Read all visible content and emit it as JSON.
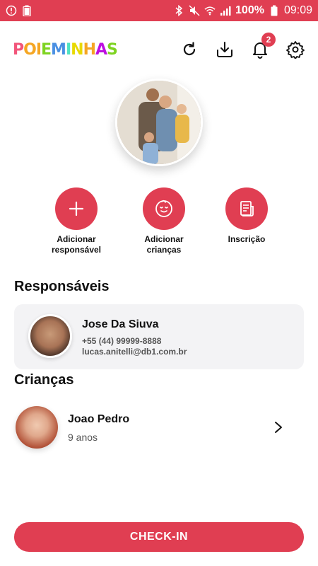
{
  "status_bar": {
    "battery_percent": "100%",
    "time": "09:09",
    "background": "#e03e52"
  },
  "header": {
    "logo_letters": [
      "P",
      "O",
      "I",
      "E",
      "M",
      "I",
      "N",
      "H",
      "A",
      "S"
    ],
    "logo_colors": [
      "#f2557a",
      "#f5a623",
      "#f5a623",
      "#7ed321",
      "#4a90e2",
      "#50e3c2",
      "#e8d900",
      "#f5a623",
      "#bd10e0",
      "#7ed321"
    ],
    "notification_count": "2",
    "icons": [
      "refresh-icon",
      "download-icon",
      "bell-icon",
      "gear-icon"
    ]
  },
  "actions": [
    {
      "label_line1": "Adicionar",
      "label_line2": "responsável",
      "icon": "plus-icon"
    },
    {
      "label_line1": "Adicionar",
      "label_line2": "crianças",
      "icon": "baby-face-icon"
    },
    {
      "label_line1": "Inscrição",
      "label_line2": "",
      "icon": "document-icon"
    }
  ],
  "guardians": {
    "title": "Responsáveis",
    "items": [
      {
        "name": "Jose Da Siuva",
        "phone": "+55 (44) 99999-8888",
        "email": "lucas.anitelli@db1.com.br"
      }
    ]
  },
  "children": {
    "title": "Crianças",
    "items": [
      {
        "name": "Joao Pedro",
        "age": "9 anos"
      }
    ]
  },
  "checkin_label": "CHECK-IN",
  "accent_color": "#e03e52"
}
